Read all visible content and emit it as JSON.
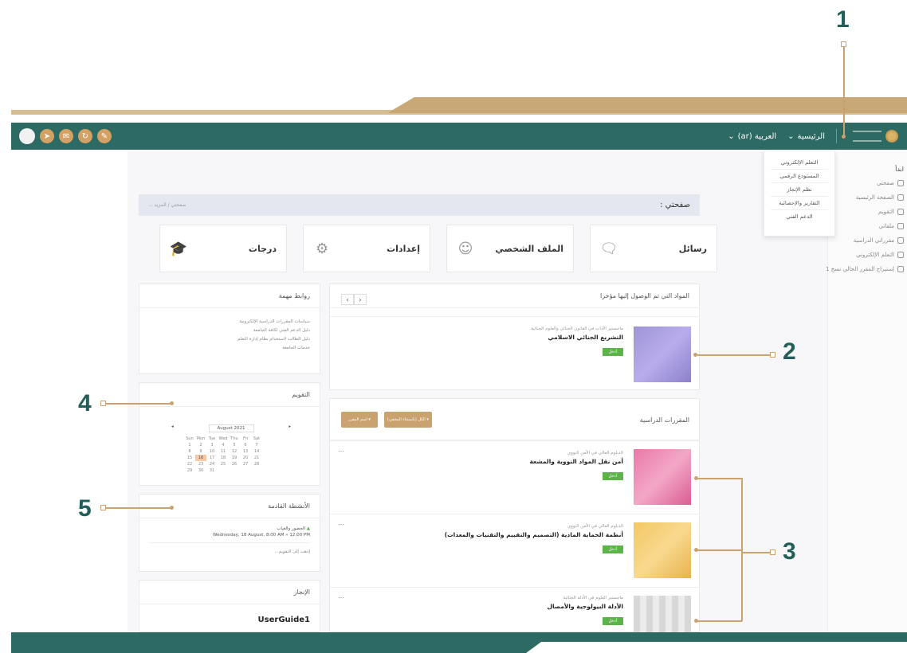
{
  "navbar": {
    "home_label": "الرئيسية",
    "language_label": "العربية (ar)",
    "icons": [
      "avatar",
      "send-icon",
      "chat-icon",
      "refresh-icon",
      "message-icon"
    ]
  },
  "dropdown": {
    "items": [
      "التعلم الإلكتروني",
      "المستودع الرقمي",
      "نظم الإنجاز",
      "التقارير والإحصائية",
      "الدعم الفني"
    ]
  },
  "sidebar": {
    "heading": "ابدأ",
    "items": [
      "صفحتي",
      "الصفحة الرئيسية",
      "التقويم",
      "ملفاتي",
      "مقرراتي الدراسية",
      "التعلم الإلكتروني",
      "إستيراج المقرر الحالي نسخ 1"
    ]
  },
  "breadcrumb": {
    "title": "صفحتي :",
    "trail": "صفحتي  /  المزيد ..."
  },
  "tiles": {
    "messages": "رسائل",
    "profile": "الملف الشخصي",
    "settings": "إعدادات",
    "grades": "درجات"
  },
  "recent": {
    "title": "المواد التي تم الوصول إليها مؤخرا",
    "course": {
      "category": "ماجستير الآداب في القانون الجنائي والعلوم الجنائية",
      "name": "التشريع الجنائي الاسلامي",
      "button": "أدخل"
    }
  },
  "courses": {
    "title": "المقررات الدراسية",
    "filter_btn_1": "الكل (باستثناء المخفي) ▾",
    "filter_btn_2": "اسم المقرر ▾",
    "items": [
      {
        "category": "الدبلوم العالي في الأمن النووي",
        "name": "أمن نقل المواد النووية والمشعة",
        "button": "أدخل"
      },
      {
        "category": "الدبلوم العالي في الأمن النووي",
        "name": "أنظمة الحماية المادية (التصميم والتقييم والتقنيات والمعدات)",
        "button": "أدخل"
      },
      {
        "category": "ماجستير العلوم في الأدلة الجنائية",
        "name": "الأدلة البيولوجية والأمصال",
        "button": "أدخل"
      }
    ],
    "colors": [
      "#e879a8",
      "#f3c765",
      "#d6d6d6"
    ]
  },
  "links": {
    "title": "روابط مهمة",
    "items": [
      "سياسات المقررات الدراسية الإلكترونية",
      "دليل الدعم الفني لكافة الجامعة",
      "دليل الطالب لاستخدام نظام إدارة التعلم",
      "خدمات الجامعة"
    ]
  },
  "calendar": {
    "title": "التقويم",
    "month": "August 2021",
    "days": [
      "Sun",
      "Mon",
      "Tue",
      "Wed",
      "Thu",
      "Fri",
      "Sat"
    ],
    "weeks": [
      [
        "1",
        "2",
        "3",
        "4",
        "5",
        "6",
        "7"
      ],
      [
        "8",
        "9",
        "10",
        "11",
        "12",
        "13",
        "14"
      ],
      [
        "15",
        "16",
        "17",
        "18",
        "19",
        "20",
        "21"
      ],
      [
        "22",
        "23",
        "24",
        "25",
        "26",
        "27",
        "28"
      ],
      [
        "29",
        "30",
        "31",
        "",
        "",
        "",
        ""
      ]
    ]
  },
  "upcoming": {
    "title": "الأنشطة القادمة",
    "event_name": "الحضور والغياب",
    "event_time": "Wednesday, 18 August, 8:00 AM » 12:00 PM",
    "more_link": "إذهب إلى التقويم..."
  },
  "achievement": {
    "title": "الإنجاز",
    "item": "UserGuide1"
  },
  "callouts": [
    "1",
    "2",
    "3",
    "4",
    "5"
  ]
}
